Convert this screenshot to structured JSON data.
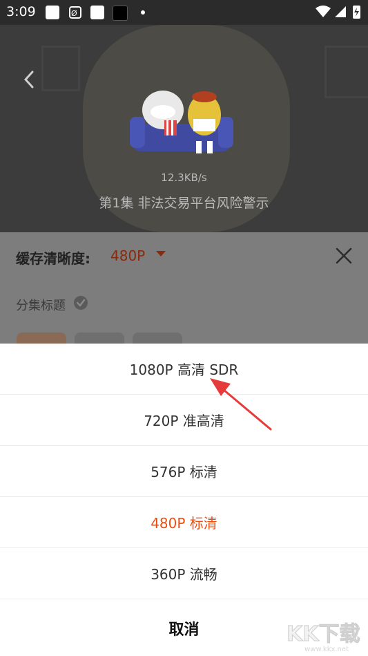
{
  "status_bar": {
    "time": "3:09"
  },
  "video": {
    "speed": "12.3KB/s",
    "episode_title": "第1集 非法交易平台风险警示"
  },
  "panel": {
    "cache_label": "缓存清晰度:",
    "cache_value": "480P",
    "episode_label": "分集标题"
  },
  "sheet": {
    "options": [
      {
        "label": "1080P 高清 SDR",
        "selected": false
      },
      {
        "label": "720P 准高清",
        "selected": false
      },
      {
        "label": "576P 标清",
        "selected": false
      },
      {
        "label": "480P 标清",
        "selected": true
      },
      {
        "label": "360P 流畅",
        "selected": false
      }
    ],
    "cancel": "取消"
  },
  "watermark": {
    "text": "KK下载",
    "url": "www.kkx.net"
  },
  "colors": {
    "accent": "#ee4e12",
    "annotation_arrow": "#e63b3b"
  }
}
